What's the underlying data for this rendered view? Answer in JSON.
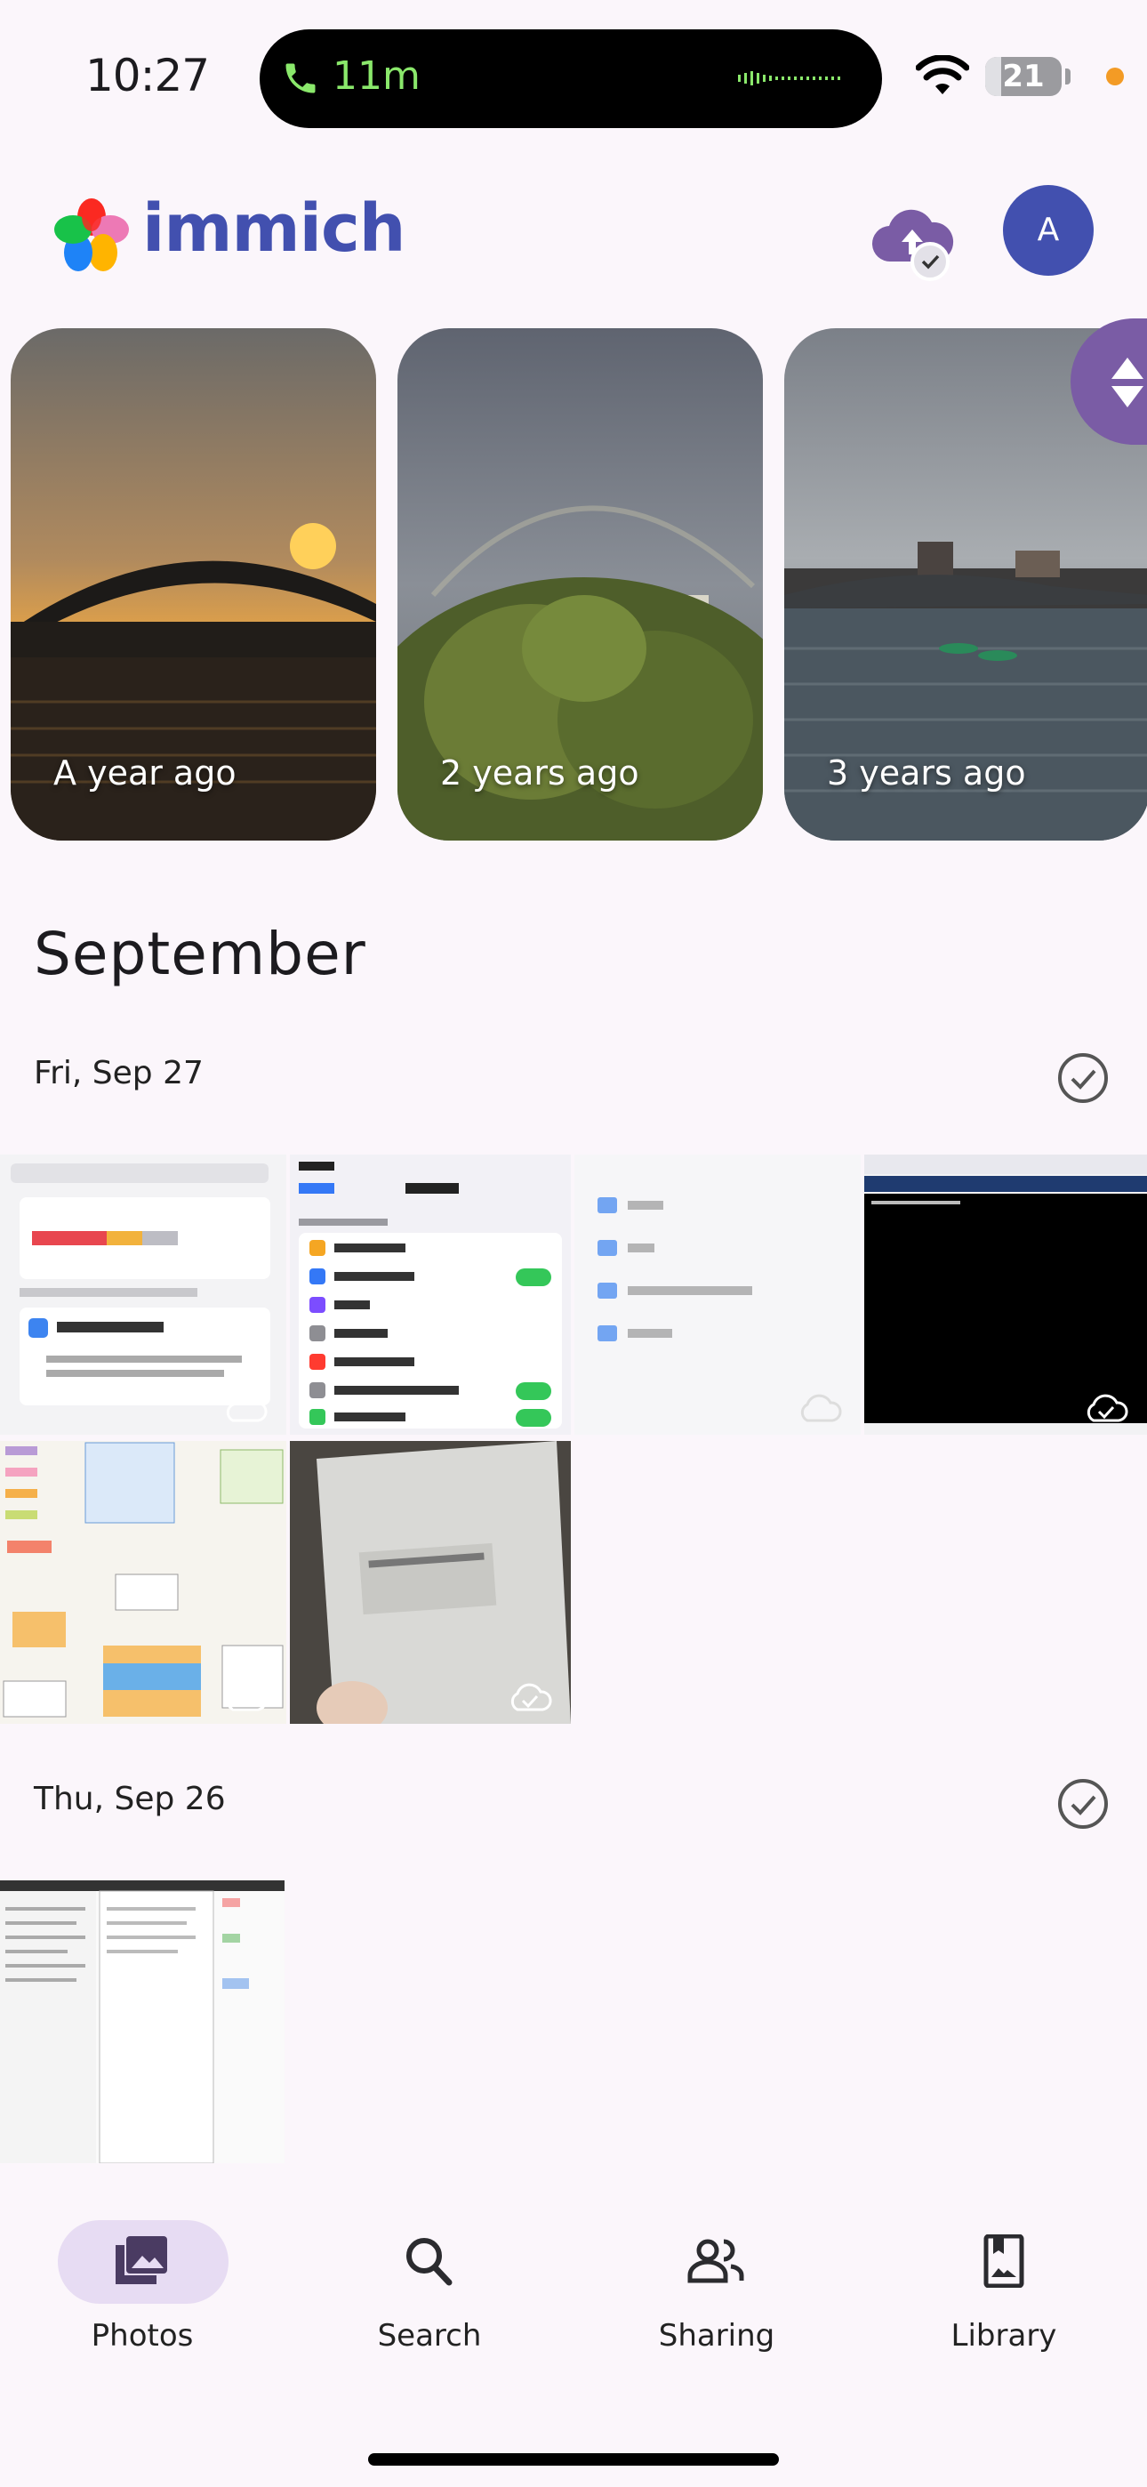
{
  "status_bar": {
    "time": "10:27",
    "call_duration": "11m",
    "battery_level": "21",
    "battery_fraction": 0.21
  },
  "header": {
    "app_name": "immich",
    "avatar_initial": "A",
    "brand_color": "#4250af"
  },
  "memories": [
    {
      "label": "A year ago"
    },
    {
      "label": "2 years ago"
    },
    {
      "label": "3 years ago"
    }
  ],
  "timeline": {
    "month": "September",
    "days": [
      {
        "date": "Fri, Sep 27",
        "photo_count": 6
      },
      {
        "date": "Thu, Sep 26",
        "photo_count": 1
      }
    ]
  },
  "bottom_nav": {
    "items": [
      {
        "label": "Photos",
        "icon": "photos-icon",
        "active": true
      },
      {
        "label": "Search",
        "icon": "search-icon",
        "active": false
      },
      {
        "label": "Sharing",
        "icon": "sharing-icon",
        "active": false
      },
      {
        "label": "Library",
        "icon": "library-icon",
        "active": false
      }
    ]
  },
  "colors": {
    "background": "#fbf6fb",
    "active_pill": "#e7dcf3",
    "scrubber": "#7a5ca5",
    "call_green": "#8ae86b"
  }
}
